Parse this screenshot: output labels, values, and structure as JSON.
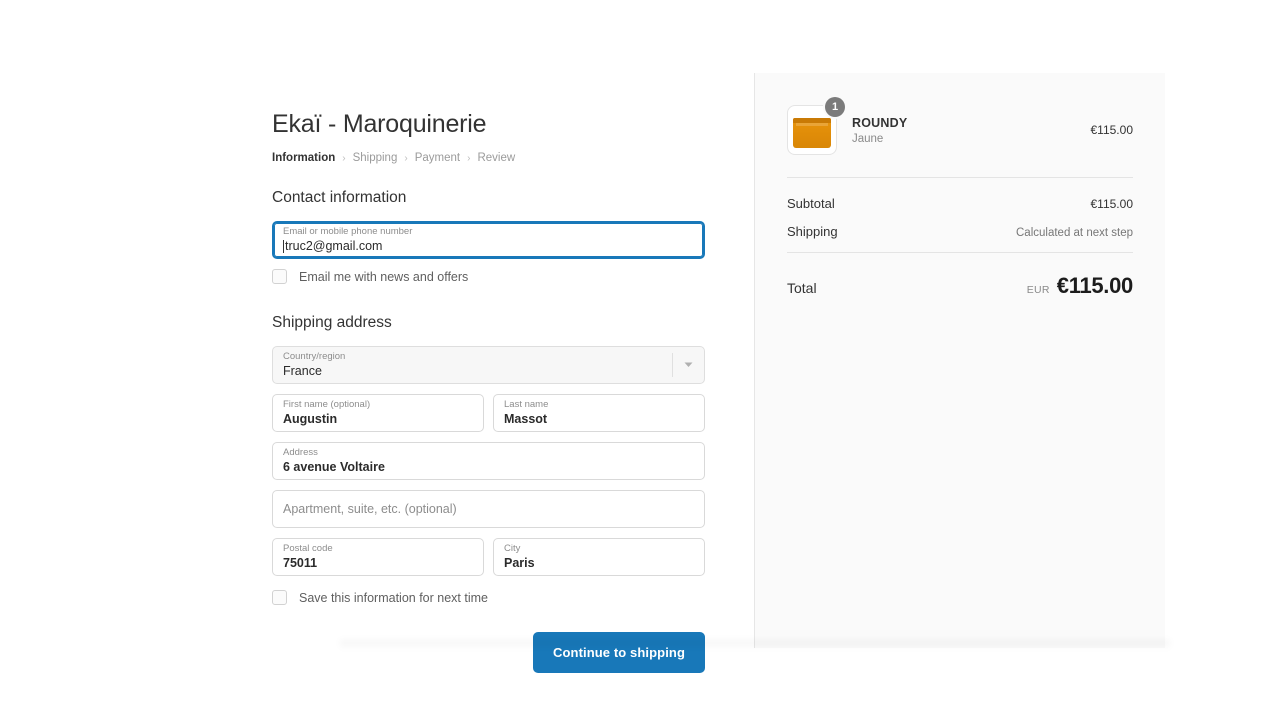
{
  "shop": {
    "title": "Ekaï - Maroquinerie"
  },
  "breadcrumb": {
    "steps": [
      {
        "label": "Information",
        "active": true
      },
      {
        "label": "Shipping",
        "active": false
      },
      {
        "label": "Payment",
        "active": false
      },
      {
        "label": "Review",
        "active": false
      }
    ],
    "separator": "›"
  },
  "contact": {
    "heading": "Contact information",
    "email": {
      "label": "Email or mobile phone number",
      "value": "truc2@gmail.com"
    },
    "newsletter_checkbox": {
      "label": "Email me with news and offers",
      "checked": false
    }
  },
  "shipping_address": {
    "heading": "Shipping address",
    "country": {
      "label": "Country/region",
      "value": "France"
    },
    "first_name": {
      "label": "First name (optional)",
      "value": "Augustin"
    },
    "last_name": {
      "label": "Last name",
      "value": "Massot"
    },
    "address": {
      "label": "Address",
      "value": "6 avenue Voltaire"
    },
    "apartment": {
      "placeholder": "Apartment, suite, etc. (optional)",
      "value": ""
    },
    "postal_code": {
      "label": "Postal code",
      "value": "75011"
    },
    "city": {
      "label": "City",
      "value": "Paris"
    },
    "save_checkbox": {
      "label": "Save this information for next time",
      "checked": false
    }
  },
  "actions": {
    "continue_label": "Continue to shipping"
  },
  "order_summary": {
    "line_items": [
      {
        "name": "ROUNDY",
        "variant": "Jaune",
        "price": "€115.00",
        "quantity": "1"
      }
    ],
    "subtotal": {
      "label": "Subtotal",
      "value": "€115.00"
    },
    "shipping": {
      "label": "Shipping",
      "value": "Calculated at next step"
    },
    "total": {
      "label": "Total",
      "currency": "EUR",
      "value": "€115.00"
    }
  },
  "colors": {
    "accent": "#1878b9",
    "product_orange": "#e08c08",
    "panel_bg": "#fafafa",
    "badge_gray": "#7b7b7b"
  }
}
